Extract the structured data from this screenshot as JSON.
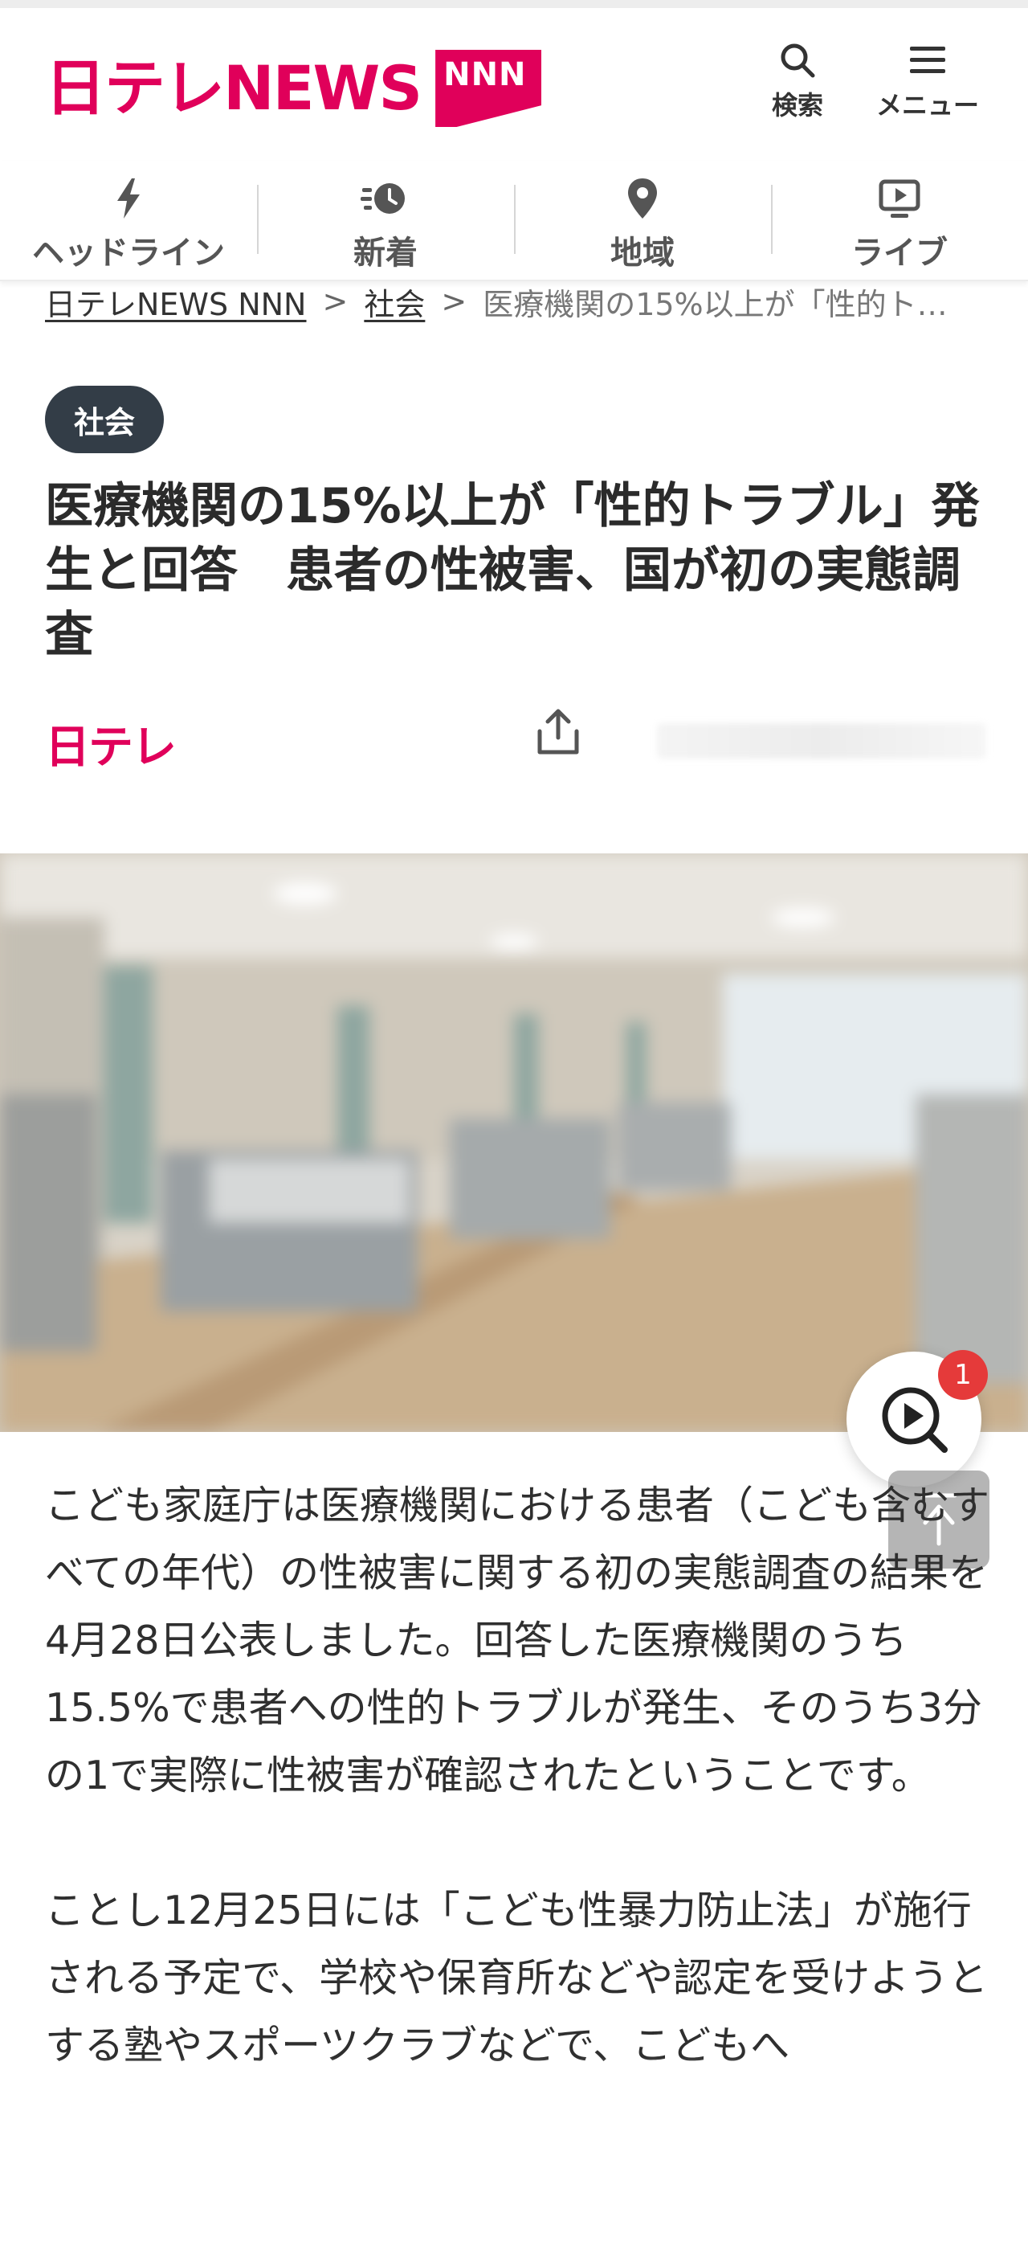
{
  "header": {
    "logo_text": "日テレNEWS",
    "logo_badge": "NNN",
    "search_label": "検索",
    "menu_label": "メニュー"
  },
  "tabs": [
    {
      "label": "ヘッドライン",
      "icon": "lightning-icon"
    },
    {
      "label": "新着",
      "icon": "clock-fast-icon"
    },
    {
      "label": "地域",
      "icon": "map-pin-icon"
    },
    {
      "label": "ライブ",
      "icon": "play-screen-icon"
    }
  ],
  "breadcrumb": {
    "home": "日テレNEWS NNN",
    "separator": ">",
    "category": "社会",
    "current": "医療機関の15%以上が「性的ト…"
  },
  "article": {
    "category": "社会",
    "title": "医療機関の15%以上が「性的トラブル」発生と回答　患者の性被害、国が初の実態調査",
    "source": "日テレ",
    "paragraphs": [
      "こども家庭庁は医療機関における患者（こども含むすべての年代）の性被害に関する初の実態調査の結果を4月28日公表しました。回答した医療機関のうち15.5%で患者への性的トラブルが発生、そのうち3分の1で実際に性被害が確認されたということです。",
      "ことし12月25日には「こども性暴力防止法」が施行される予定で、学校や保育所などや認定を受けようとする塾やスポーツクラブなどで、こどもへ"
    ]
  },
  "video_fab": {
    "badge_count": "1"
  },
  "colors": {
    "brand": "#e0005a",
    "category_bg": "#333d47",
    "badge": "#e53a3a"
  }
}
